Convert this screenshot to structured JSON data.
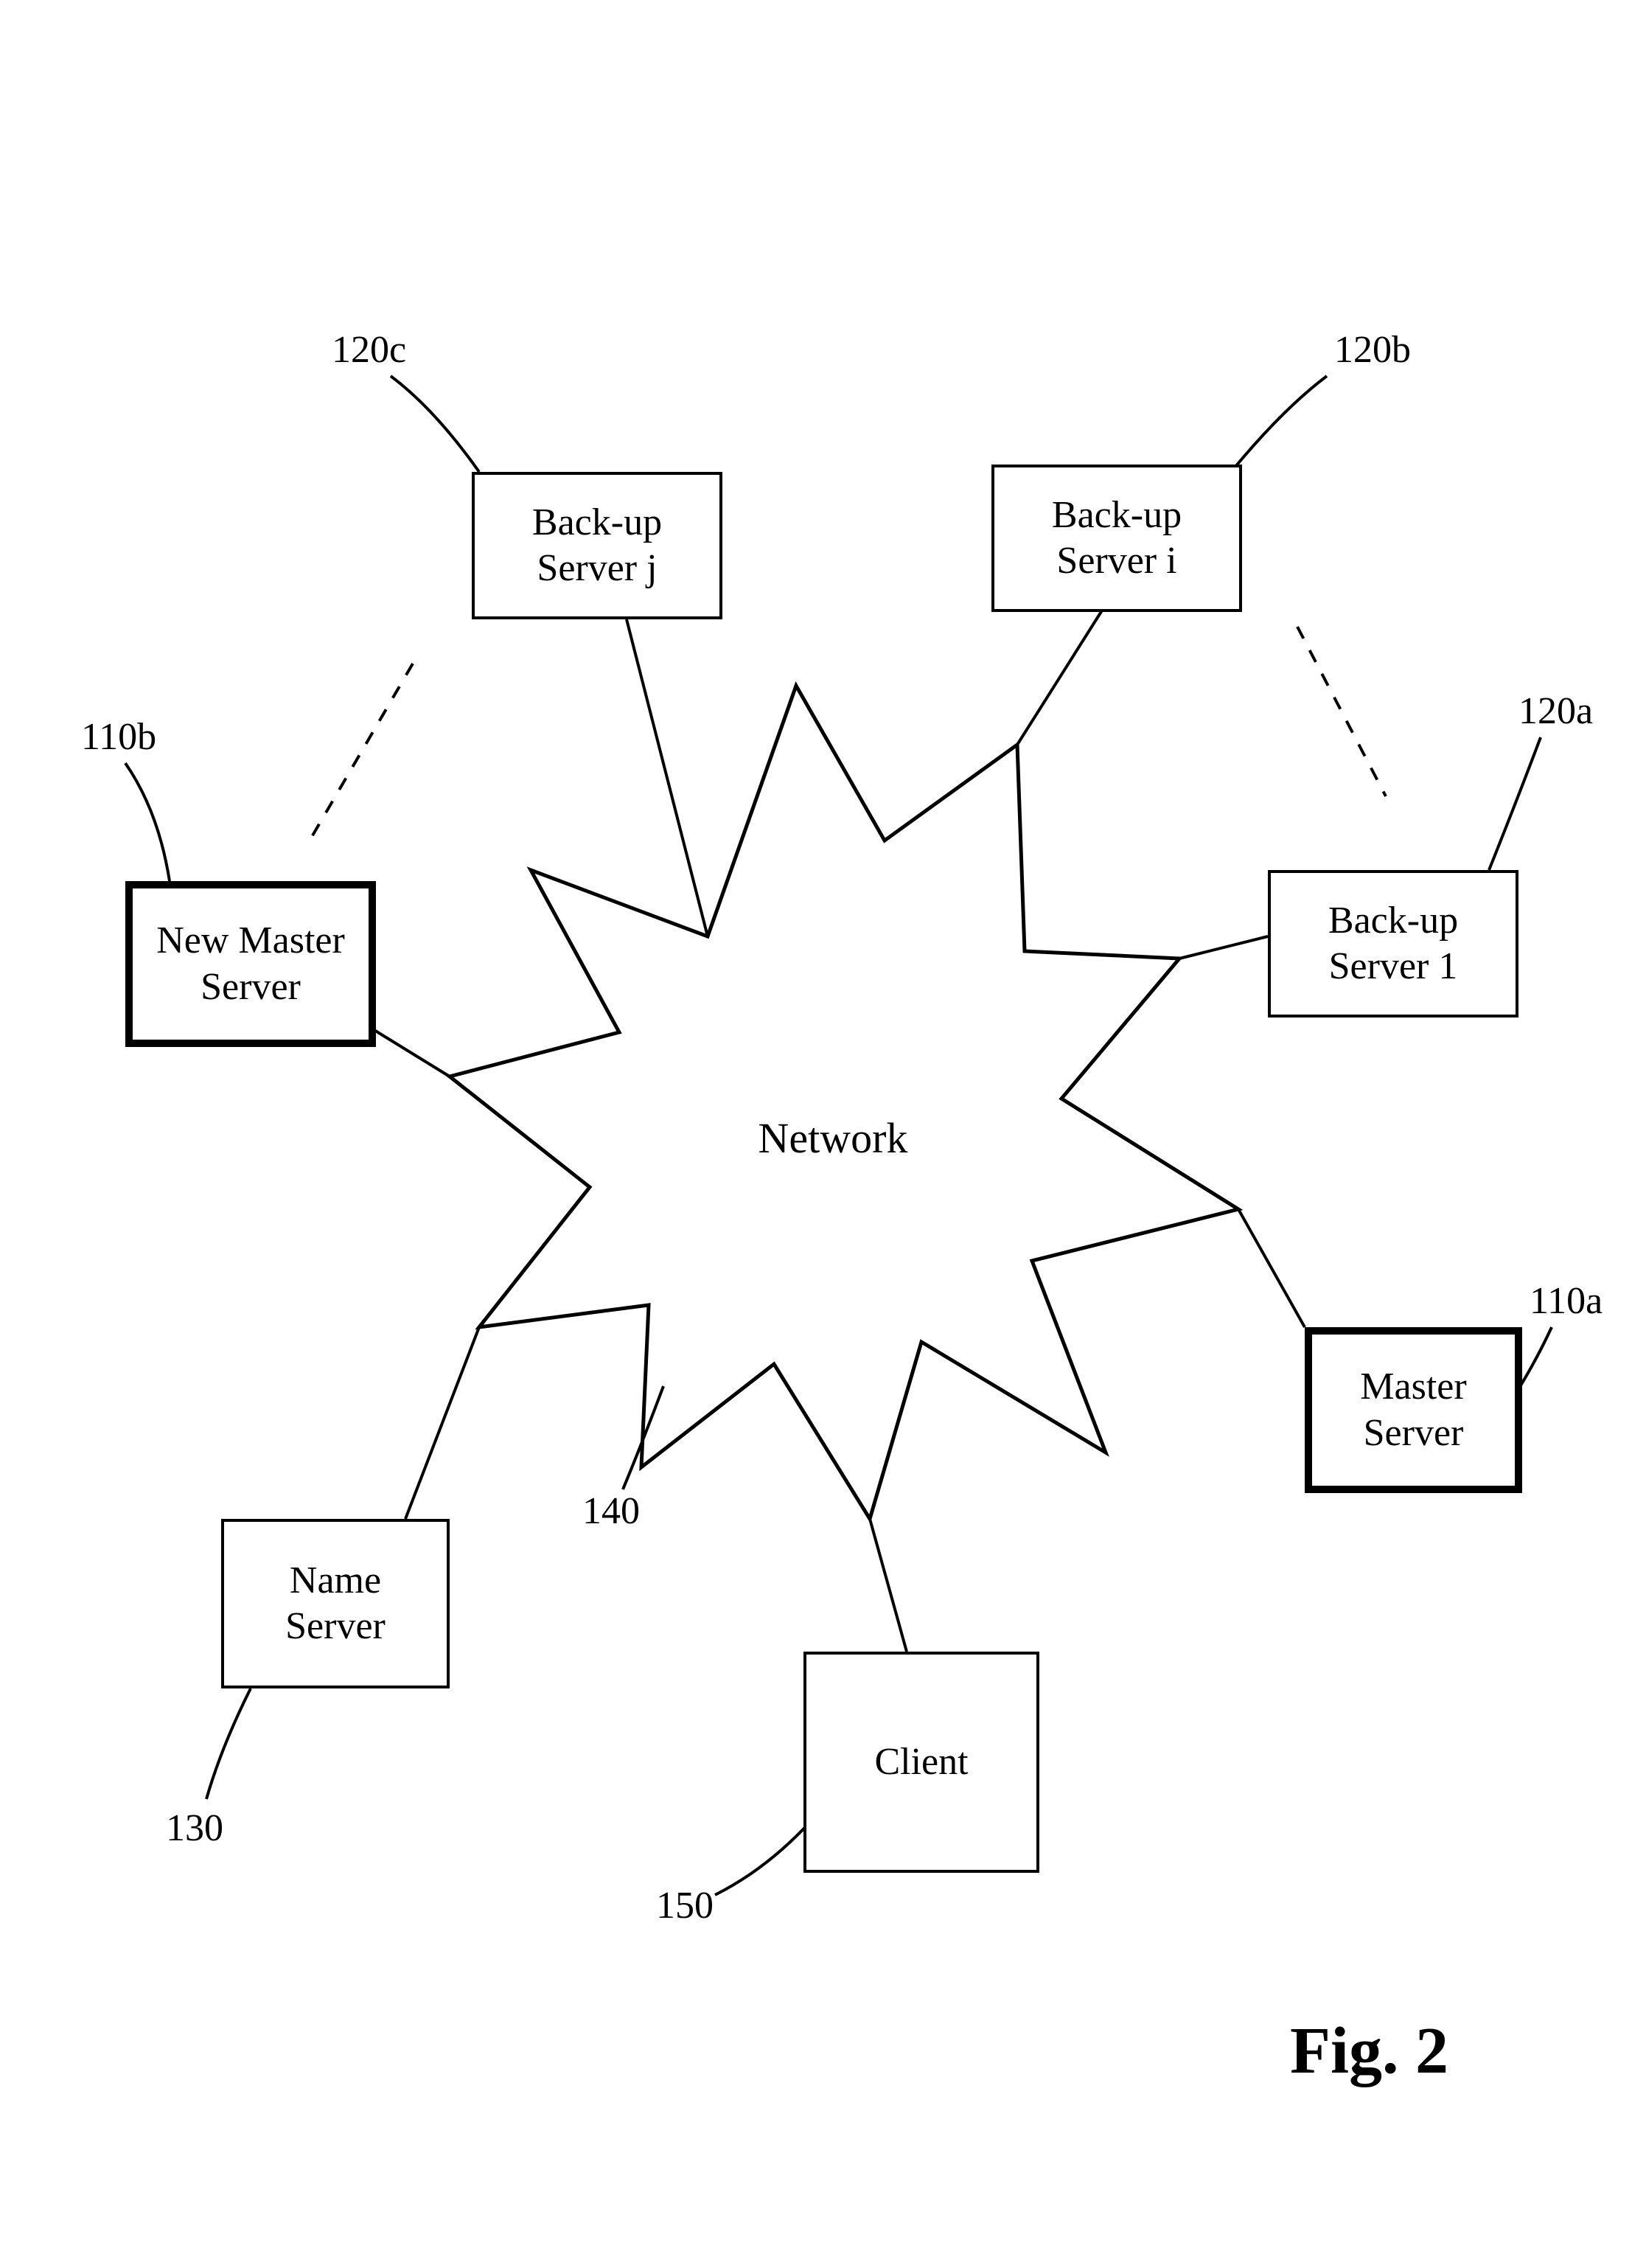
{
  "nodes": {
    "newMaster": {
      "label": "New Master\nServer",
      "ref": "110b"
    },
    "master": {
      "label": "Master\nServer",
      "ref": "110a"
    },
    "backup1": {
      "label": "Back-up\nServer 1",
      "ref": "120a"
    },
    "backupi": {
      "label": "Back-up\nServer i",
      "ref": "120b"
    },
    "backupj": {
      "label": "Back-up\nServer j",
      "ref": "120c"
    },
    "nameServer": {
      "label": "Name\nServer",
      "ref": "130"
    },
    "client": {
      "label": "Client",
      "ref": "150"
    }
  },
  "network": {
    "label": "Network",
    "ref": "140"
  },
  "figure": "Fig. 2"
}
